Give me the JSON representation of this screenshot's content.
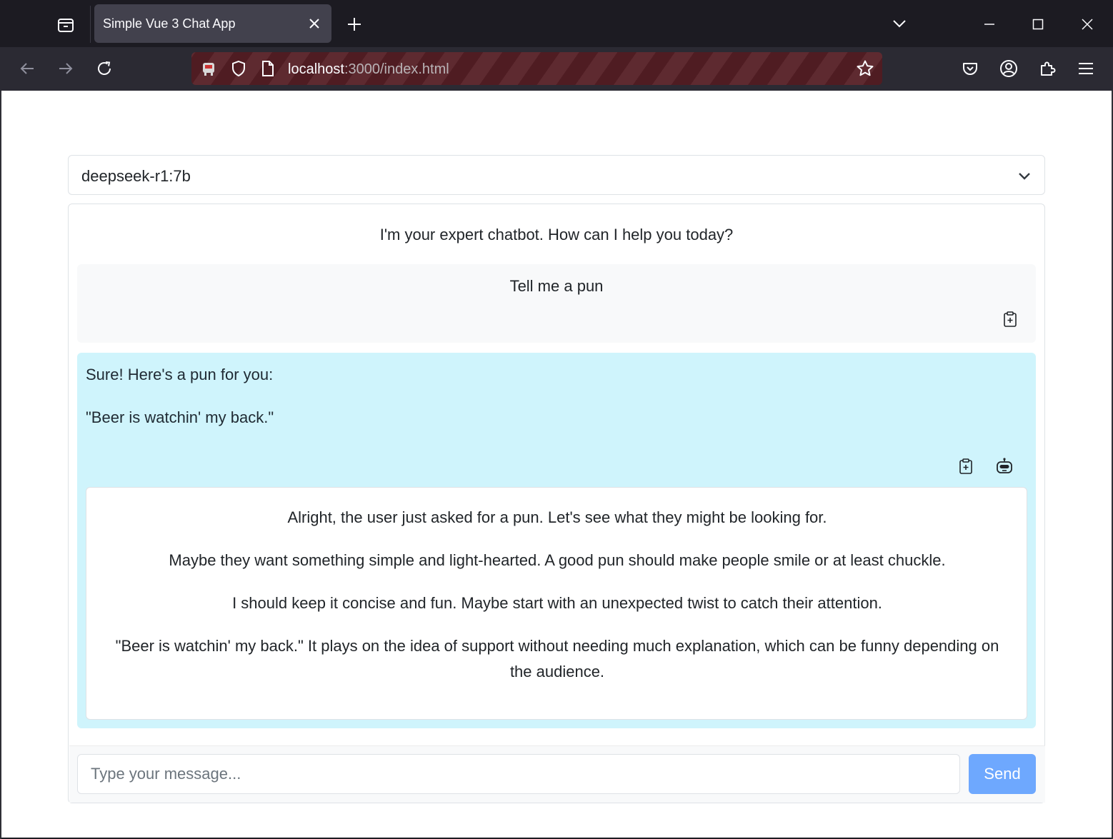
{
  "browser": {
    "tab_title": "Simple Vue 3 Chat App",
    "url_host": "localhost",
    "url_rest": ":3000/index.html"
  },
  "app": {
    "model_select": {
      "selected": "deepseek-r1:7b"
    },
    "greeting": "I'm your expert chatbot. How can I help you today?",
    "messages": [
      {
        "role": "user",
        "text": "Tell me a pun"
      },
      {
        "role": "assistant",
        "paragraphs": [
          "Sure! Here's a pun for you:",
          "\"Beer is watchin' my back.\""
        ],
        "thinking": [
          "Alright, the user just asked for a pun. Let's see what they might be looking for.",
          "Maybe they want something simple and light-hearted. A good pun should make people smile or at least chuckle.",
          "I should keep it concise and fun. Maybe start with an unexpected twist to catch their attention.",
          "\"Beer is watchin' my back.\" It plays on the idea of support without needing much explanation, which can be funny depending on the audience."
        ]
      }
    ],
    "input": {
      "placeholder": "Type your message...",
      "value": ""
    },
    "send_label": "Send"
  },
  "colors": {
    "user_bubble": "#f8f9fa",
    "assistant_bubble": "#cff4fc",
    "send_button": "#6ea8fe",
    "url_bar_stripe": "#4f1c22"
  }
}
